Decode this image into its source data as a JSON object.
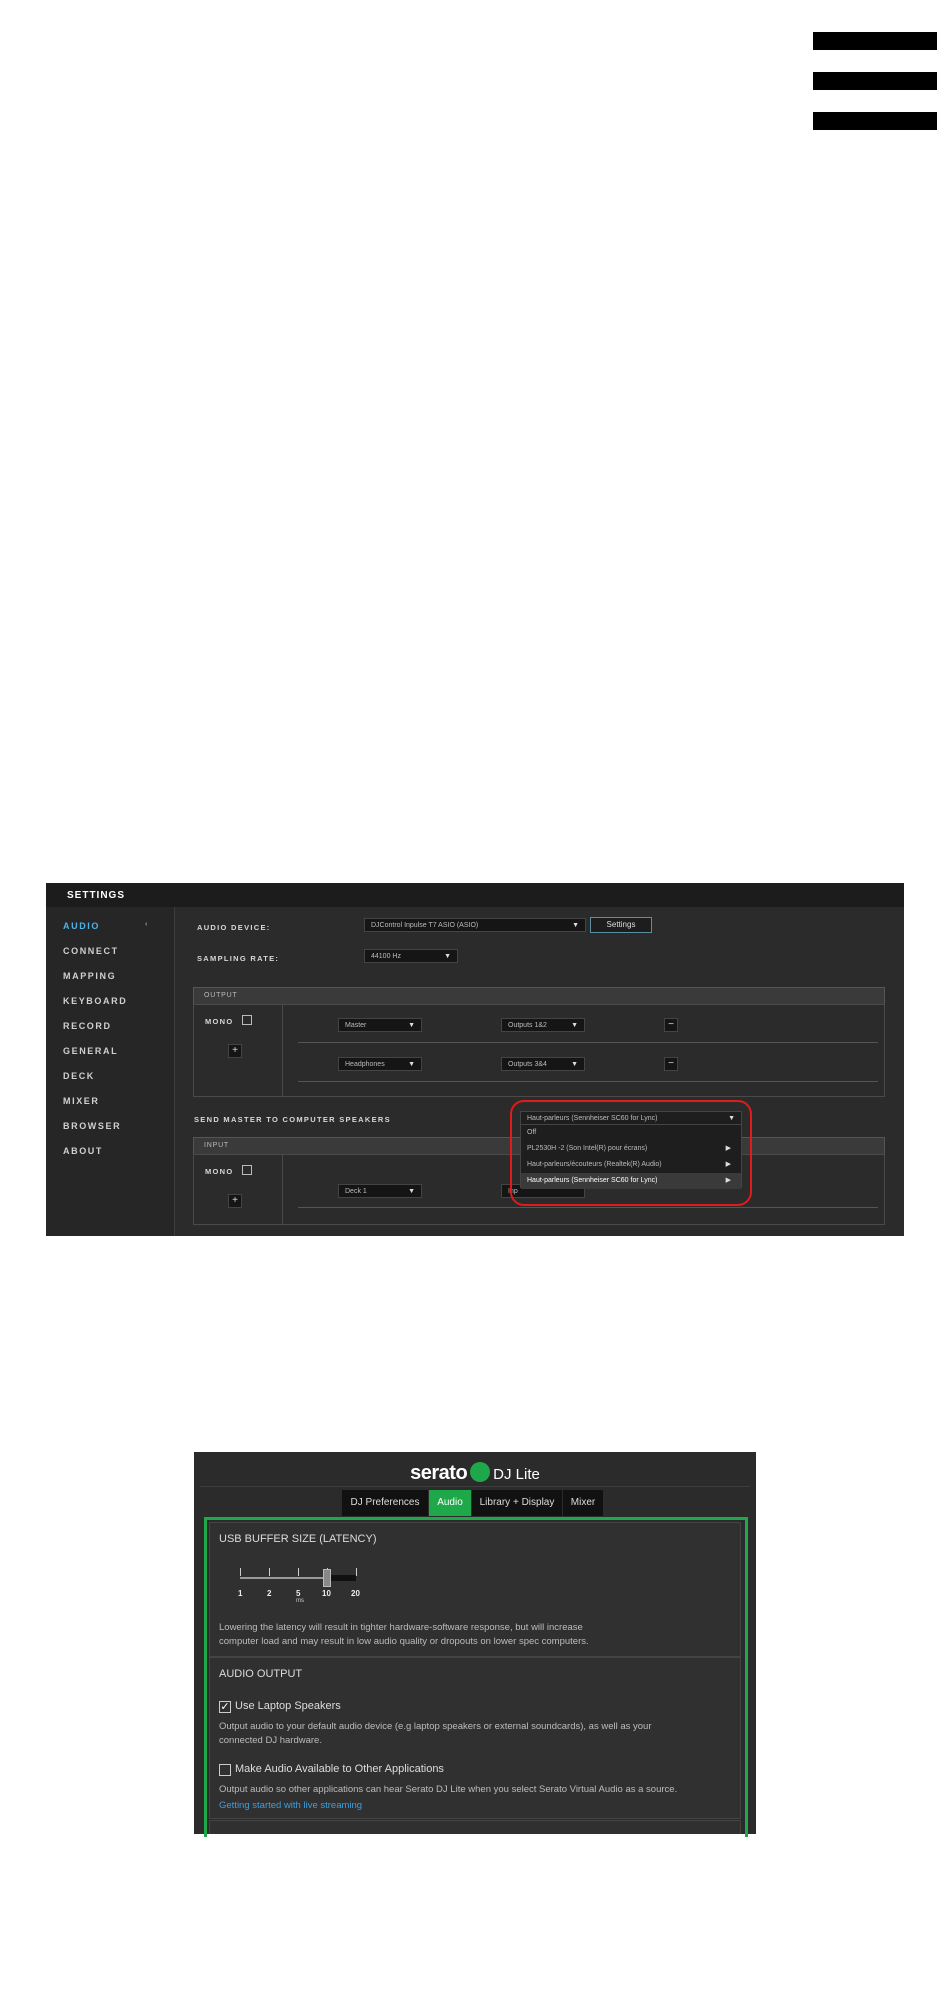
{
  "menu": {
    "icon": "hamburger-menu-icon"
  },
  "settings": {
    "title": "SETTINGS",
    "sidebar": [
      {
        "label": "AUDIO",
        "active": true
      },
      {
        "label": "CONNECT"
      },
      {
        "label": "MAPPING"
      },
      {
        "label": "KEYBOARD"
      },
      {
        "label": "RECORD"
      },
      {
        "label": "GENERAL"
      },
      {
        "label": "DECK"
      },
      {
        "label": "MIXER"
      },
      {
        "label": "BROWSER"
      },
      {
        "label": "ABOUT"
      }
    ],
    "audio_device_label": "AUDIO DEVICE:",
    "audio_device_value": "DJControl Inpulse T7 ASIO (ASIO)",
    "settings_button": "Settings",
    "sampling_rate_label": "SAMPLING RATE:",
    "sampling_rate_value": "44100 Hz",
    "output_header": "OUTPUT",
    "mono_label": "MONO",
    "add_symbol": "+",
    "remove_symbol": "−",
    "output_rows": [
      {
        "channel": "Master",
        "outputs": "Outputs 1&2"
      },
      {
        "channel": "Headphones",
        "outputs": "Outputs 3&4"
      }
    ],
    "send_master_label": "SEND MASTER TO COMPUTER SPEAKERS",
    "send_master_value": "Haut-parleurs (Sennheiser SC60 for Lync)",
    "send_master_options": [
      {
        "label": "Off",
        "submenu": false
      },
      {
        "label": "PL2530H -2 (Son Intel(R) pour écrans)",
        "submenu": true
      },
      {
        "label": "Haut-parleurs/écouteurs (Realtek(R) Audio)",
        "submenu": true
      },
      {
        "label": "Haut-parleurs (Sennheiser SC60 for Lync)",
        "submenu": true,
        "selected": true
      }
    ],
    "input_header": "INPUT",
    "input_row": {
      "channel": "Deck 1",
      "inputs": "Inp"
    }
  },
  "serato": {
    "brand_wordmark": "serato",
    "product": "DJ Lite",
    "tabs": [
      {
        "label": "DJ Preferences"
      },
      {
        "label": "Audio",
        "active": true
      },
      {
        "label": "Library + Display"
      },
      {
        "label": "Mixer"
      }
    ],
    "buffer": {
      "title": "USB BUFFER SIZE (LATENCY)",
      "ticks": [
        "1",
        "2",
        "5",
        "10",
        "20"
      ],
      "unit": "ms",
      "value": 10,
      "note_line1": "Lowering the latency will result in tighter hardware-software response, but will increase",
      "note_line2": "computer load and may result in low audio quality or dropouts on lower spec computers."
    },
    "audio_output": {
      "title": "AUDIO OUTPUT",
      "use_laptop_label": "Use Laptop Speakers",
      "use_laptop_checked": true,
      "use_laptop_desc1": "Output audio to your default audio device (e.g laptop speakers or external soundcards), as well as your",
      "use_laptop_desc2": "connected DJ hardware.",
      "make_available_label": "Make Audio Available to Other Applications",
      "make_available_checked": false,
      "make_available_desc": "Output audio so other applications can hear Serato DJ Lite when you select Serato Virtual Audio as a source.",
      "link": "Getting started with live streaming"
    },
    "colors": {
      "accent": "#1fa84a",
      "link": "#3aa0e0",
      "highlight": "#4fb3e8",
      "callout": "#e01b1b"
    }
  }
}
